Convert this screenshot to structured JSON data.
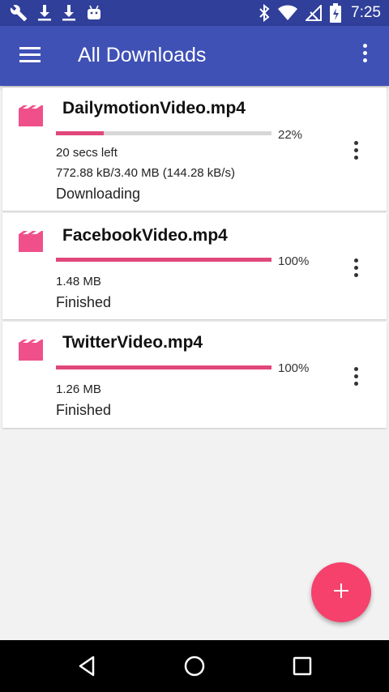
{
  "status_bar": {
    "time": "7:25",
    "left_icons": [
      "wrench-icon",
      "download-icon",
      "download-icon",
      "android-icon"
    ],
    "right_icons": [
      "bluetooth-icon",
      "wifi-icon",
      "no-signal-icon",
      "battery-charging-icon"
    ]
  },
  "app_bar": {
    "title": "All Downloads",
    "menu_icon": "hamburger-icon",
    "overflow_icon": "more-vert-icon",
    "color": "#3f51b5"
  },
  "downloads": [
    {
      "filename": "DailymotionVideo.mp4",
      "progress": 22,
      "percent_label": "22%",
      "time_left": "20 secs left",
      "size": "772.88 kB/3.40 MB (144.28 kB/s)",
      "status": "Downloading"
    },
    {
      "filename": "FacebookVideo.mp4",
      "progress": 100,
      "percent_label": "100%",
      "size": "1.48 MB",
      "status": "Finished"
    },
    {
      "filename": "TwitterVideo.mp4",
      "progress": 100,
      "percent_label": "100%",
      "size": "1.26 MB",
      "status": "Finished"
    }
  ],
  "fab": {
    "icon": "plus-icon",
    "color": "#f5416c"
  },
  "nav_bar": {
    "buttons": [
      "back-icon",
      "home-icon",
      "recents-icon"
    ]
  },
  "colors": {
    "accent": "#e0487a",
    "track": "#d7d7d7",
    "status_bar": "#2f3f9a"
  }
}
